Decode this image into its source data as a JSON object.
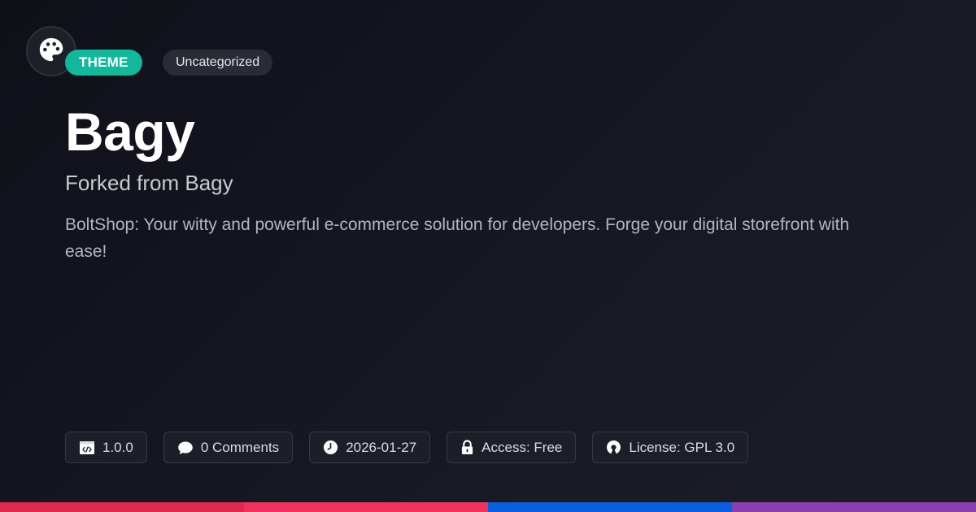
{
  "header": {
    "logo_icon": "palette-icon",
    "type_badge": "THEME",
    "category_badge": "Uncategorized"
  },
  "main": {
    "title": "Bagy",
    "subtitle": "Forked from Bagy",
    "description": "BoltShop: Your witty and powerful e-commerce solution for developers. Forge your digital storefront with ease!"
  },
  "meta": {
    "version": {
      "icon": "code-window-icon",
      "text": "1.0.0"
    },
    "comments": {
      "icon": "comment-icon",
      "text": "0 Comments"
    },
    "date": {
      "icon": "clock-icon",
      "text": "2026-01-27"
    },
    "access": {
      "icon": "lock-icon",
      "text": "Access: Free"
    },
    "license": {
      "icon": "open-source-icon",
      "text": "License: GPL 3.0"
    }
  },
  "colors": {
    "background": "#13151d",
    "accent_theme_badge": "#12b89c",
    "bar_segments": [
      "#e0294f",
      "#f2315f",
      "#0a5ee0",
      "#8b3fb0"
    ]
  }
}
